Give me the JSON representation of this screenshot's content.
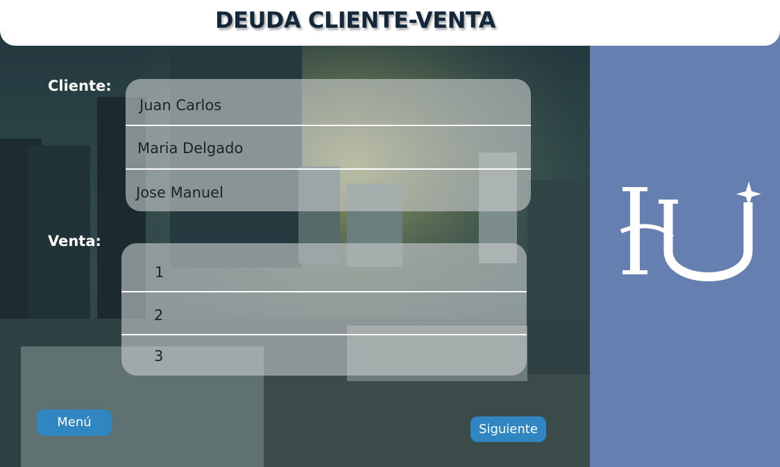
{
  "header": {
    "title": "DEUDA CLIENTE-VENTA"
  },
  "cliente": {
    "label": "Cliente:",
    "options": [
      "Juan Carlos",
      "Maria Delgado",
      "Jose Manuel"
    ]
  },
  "venta": {
    "label": "Venta:",
    "options": [
      "1",
      "2",
      "3"
    ]
  },
  "buttons": {
    "menu": "Menú",
    "next": "Siguiente"
  },
  "logo": {
    "icon": "hu-monogram-logo"
  },
  "colors": {
    "side_panel": "#6580b0",
    "button": "#2f86c0",
    "title": "#13283a"
  }
}
